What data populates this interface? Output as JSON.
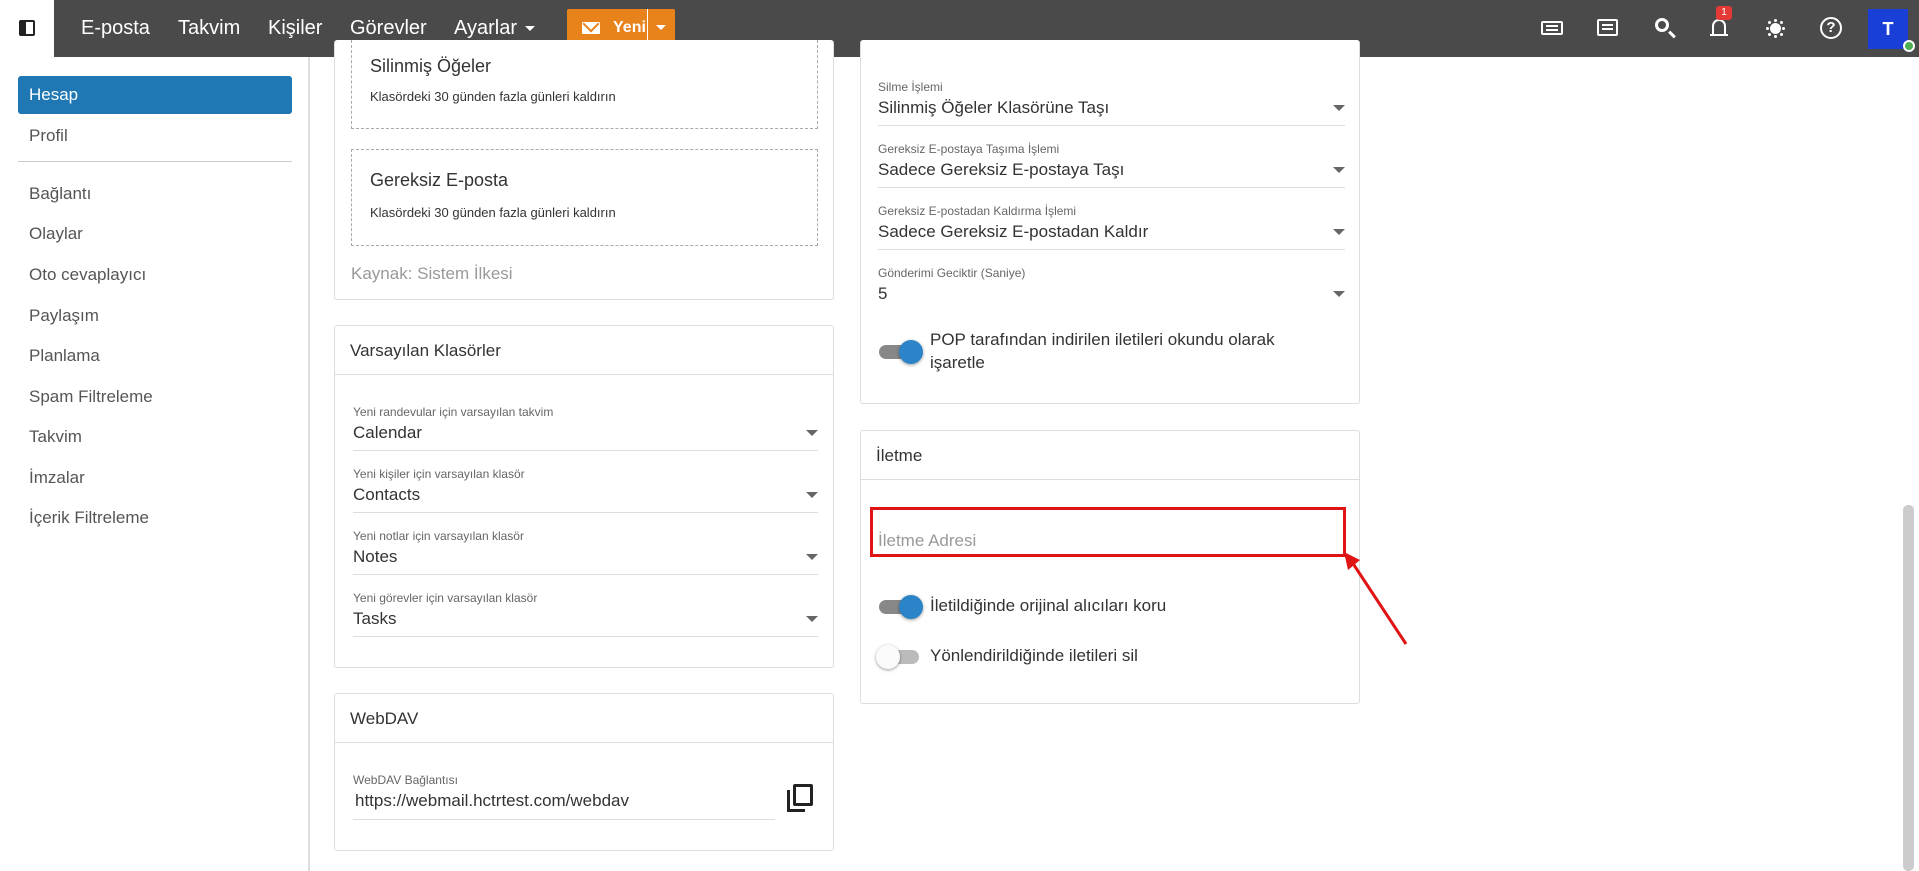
{
  "topbar": {
    "nav": [
      "E-posta",
      "Takvim",
      "Kişiler",
      "Görevler",
      "Ayarlar"
    ],
    "new_label": "Yeni",
    "notification_count": "1",
    "avatar_initial": "T"
  },
  "sidebar": {
    "items": [
      "Hesap",
      "Profil",
      "Bağlantı",
      "Olaylar",
      "Oto cevaplayıcı",
      "Paylaşım",
      "Planlama",
      "Spam Filtreleme",
      "Takvim",
      "İmzalar",
      "İçerik Filtreleme"
    ]
  },
  "retention": {
    "deleted_title": "Silinmiş Öğeler",
    "deleted_sub": "Klasördeki 30 günden fazla günleri kaldırın",
    "junk_title": "Gereksiz E-posta",
    "junk_sub": "Klasördeki 30 günden fazla günleri kaldırın",
    "source": "Kaynak: Sistem İlkesi"
  },
  "default_folders": {
    "title": "Varsayılan Klasörler",
    "fields": [
      {
        "label": "Yeni randevular için varsayılan takvim",
        "value": "Calendar"
      },
      {
        "label": "Yeni kişiler için varsayılan klasör",
        "value": "Contacts"
      },
      {
        "label": "Yeni notlar için varsayılan klasör",
        "value": "Notes"
      },
      {
        "label": "Yeni görevler için varsayılan klasör",
        "value": "Tasks"
      }
    ]
  },
  "webdav": {
    "title": "WebDAV",
    "label": "WebDAV Bağlantısı",
    "value": "https://webmail.hctrtest.com/webdav"
  },
  "actions": {
    "fields": [
      {
        "label": "Silme İşlemi",
        "value": "Silinmiş Öğeler Klasörüne Taşı"
      },
      {
        "label": "Gereksiz E-postaya Taşıma İşlemi",
        "value": "Sadece Gereksiz E-postaya Taşı"
      },
      {
        "label": "Gereksiz E-postadan Kaldırma İşlemi",
        "value": "Sadece Gereksiz E-postadan Kaldır"
      },
      {
        "label": "Gönderimi Geciktir (Saniye)",
        "value": "5"
      }
    ],
    "pop_toggle_label": "POP tarafından indirilen iletileri okundu olarak işaretle",
    "pop_toggle_on": true
  },
  "forwarding": {
    "title": "İletme",
    "address_placeholder": "İletme Adresi",
    "keep_recipients_label": "İletildiğinde orijinal alıcıları koru",
    "keep_recipients_on": true,
    "delete_redirected_label": "Yönlendirildiğinde iletileri sil",
    "delete_redirected_on": false
  },
  "colors": {
    "topbar": "#4a4a4a",
    "accent": "#1f78b4",
    "new_button": "#e8821a",
    "toggle_on": "#2c84c8",
    "highlight": "#e01414"
  }
}
